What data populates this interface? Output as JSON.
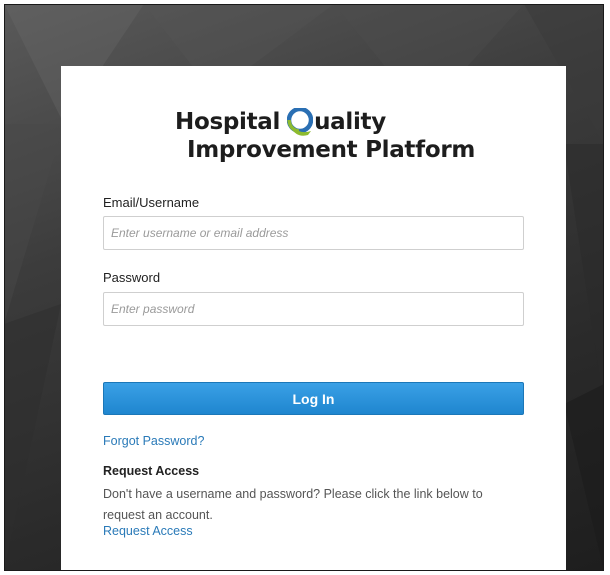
{
  "logo": {
    "line1_before": "Hospital",
    "line1_after": "uality",
    "line2": "Improvement Platform"
  },
  "form": {
    "email_label": "Email/Username",
    "email_placeholder": "Enter username or email address",
    "email_value": "",
    "password_label": "Password",
    "password_placeholder": "Enter password",
    "password_value": "",
    "login_label": "Log In"
  },
  "links": {
    "forgot_password": "Forgot Password?",
    "request_access": "Request Access"
  },
  "request_section": {
    "title": "Request Access",
    "description": "Don't have a username and password? Please click the link below to request an account."
  },
  "colors": {
    "primary_button": "#2b93dc",
    "link": "#2a7ab8",
    "logo_q_blue": "#2a6fb3",
    "logo_q_green": "#8dbb2f"
  },
  "icons": {
    "logo_q": "logo-q-icon"
  }
}
